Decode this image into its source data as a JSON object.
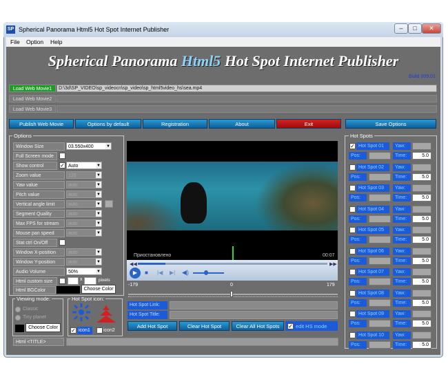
{
  "window": {
    "title": "Spherical Panorama Html5 Hot Spot Internet Publisher",
    "icon": "SP"
  },
  "menu": [
    "File",
    "Option",
    "Help"
  ],
  "banner": {
    "part1": "Spherical Panorama ",
    "html5": "Html5",
    "part2": " Hot Spot Internet Publisher",
    "build": "Build 009.01"
  },
  "movies": [
    {
      "label": "Load Web Movie1",
      "path": "D:\\3d\\SP_VIDEO\\sp_videocn\\sp_video\\sp_html5video_hs\\sea.mp4"
    },
    {
      "label": "Load Web Movie2",
      "path": ""
    },
    {
      "label": "Load Web Movie3",
      "path": ""
    }
  ],
  "toolbar": {
    "publish": "Publish Web Movie",
    "defaults": "Options by default",
    "registration": "Registration",
    "about": "About",
    "exit": "Exit",
    "save": "Save Options"
  },
  "options": {
    "title": "Options",
    "rows": [
      {
        "label": "Window Size",
        "value": "03.550x400"
      },
      {
        "label": "Full Screen mode",
        "value": ""
      },
      {
        "label": "Show control",
        "value": "Auto"
      },
      {
        "label": "Zoom value",
        "value": "120"
      },
      {
        "label": "Yaw value",
        "value": "auto"
      },
      {
        "label": "Pitch value",
        "value": "auto"
      },
      {
        "label": "Vertical angle limit",
        "value": "auto"
      },
      {
        "label": "Segment Quality",
        "value": "auto"
      },
      {
        "label": "Max FPS for stream",
        "value": "auto"
      },
      {
        "label": "Mouse pan speed",
        "value": "auto"
      },
      {
        "label": "Stat ctrl On/Off",
        "value": ""
      },
      {
        "label": "Window X-position",
        "value": "auto"
      },
      {
        "label": "Window Y-position",
        "value": "auto"
      },
      {
        "label": "Audio Volume",
        "value": "50%"
      }
    ],
    "html_size_label": "Html custom size",
    "x_label": "x",
    "pixels_label": "pixels",
    "bgcolor_label": "Html BGColor",
    "choose_color": "Choose Color"
  },
  "viewing": {
    "title": "Viewing mode:",
    "opt1": "Classic",
    "opt2": "Tiny planet",
    "choose_color": "Choose Color"
  },
  "hs_icon": {
    "title": "Hot Spot icon:",
    "icon1": "icon1",
    "icon2": "icon2"
  },
  "player": {
    "status": "Приостановлено",
    "time": "00:07",
    "scale_left": "-179",
    "scale_mid": "0",
    "scale_right": "179"
  },
  "hs_link": {
    "label": "Hot Spot Link:",
    "title_label": "Hot Spot Title:"
  },
  "hs_buttons": {
    "add": "Add Hot Spot",
    "clear": "Clear Hot Spot",
    "clear_all": "Clear All Hot Spots",
    "edit": "edit HS mode"
  },
  "html_title": "Html <TITLE>",
  "hotspots": {
    "title": "Hot Spots",
    "items": [
      {
        "label": "Hot Spot 01",
        "yaw": "Yaw:",
        "pos": "Pos:",
        "time": "Time:",
        "time_val": "5.0"
      },
      {
        "label": "Hot Spot 02",
        "yaw": "Yaw:",
        "pos": "Pos:",
        "time": "Time:",
        "time_val": "5.0"
      },
      {
        "label": "Hot Spot 03",
        "yaw": "Yaw:",
        "pos": "Pos:",
        "time": "Time:",
        "time_val": "5.0"
      },
      {
        "label": "Hot Spot 04",
        "yaw": "Yaw:",
        "pos": "Pos:",
        "time": "Time:",
        "time_val": "5.0"
      },
      {
        "label": "Hot Spot 05",
        "yaw": "Yaw:",
        "pos": "Pos:",
        "time": "Time:",
        "time_val": "5.0"
      },
      {
        "label": "Hot Spot 06",
        "yaw": "Yaw:",
        "pos": "Pos:",
        "time": "Time:",
        "time_val": "5.0"
      },
      {
        "label": "Hot Spot 07",
        "yaw": "Yaw:",
        "pos": "Pos:",
        "time": "Time:",
        "time_val": "5.0"
      },
      {
        "label": "Hot Spot 08",
        "yaw": "Yaw:",
        "pos": "Pos:",
        "time": "Time:",
        "time_val": "5.0"
      },
      {
        "label": "Hot Spot 09",
        "yaw": "Yaw:",
        "pos": "Pos:",
        "time": "Time:",
        "time_val": "5.0"
      },
      {
        "label": "Hot Spot 10",
        "yaw": "Yaw:",
        "pos": "Pos:",
        "time": "Time:",
        "time_val": "5.0"
      }
    ]
  },
  "colors": {
    "accent_green": "#1c9c25",
    "accent_blue": "#1b5ad8",
    "exit_red": "#c01818"
  }
}
